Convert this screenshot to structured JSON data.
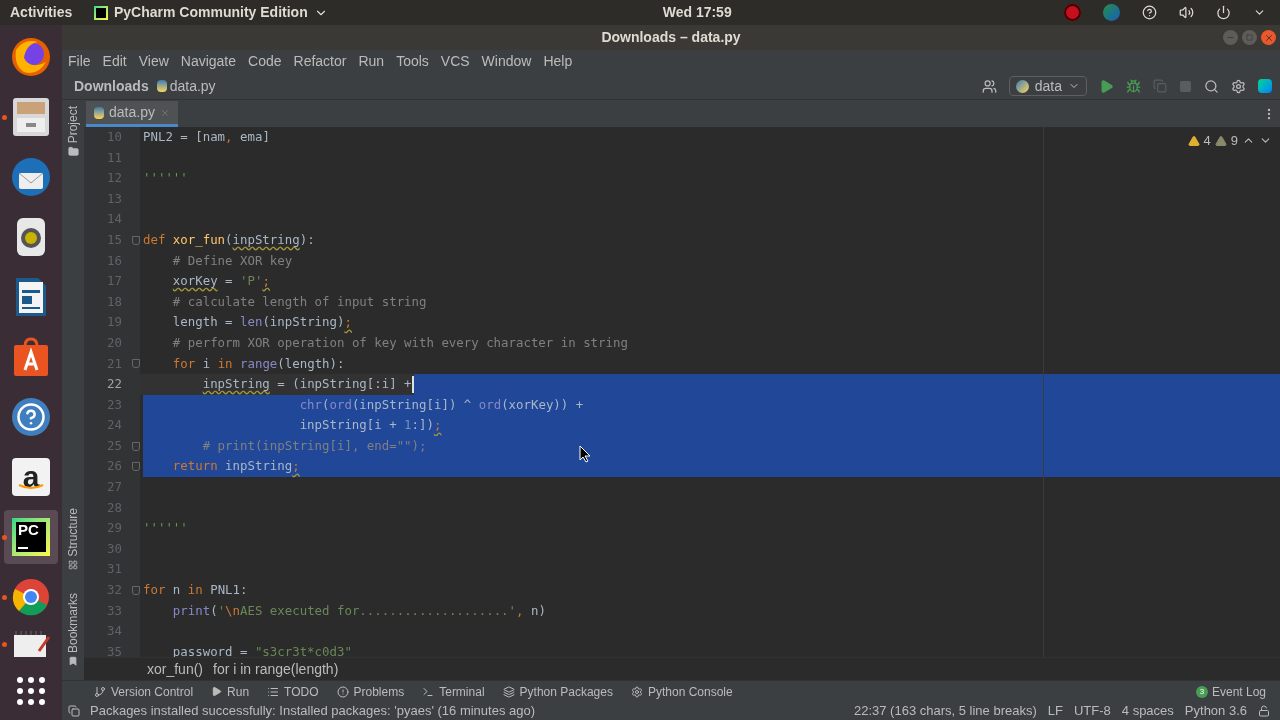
{
  "top_bar": {
    "activities": "Activities",
    "app_menu": "PyCharm Community Edition",
    "clock": "Wed 17:59"
  },
  "dock": [
    {
      "kind": "firefox",
      "running": false,
      "selected": false
    },
    {
      "kind": "files",
      "running": true,
      "selected": false
    },
    {
      "kind": "mail",
      "running": false,
      "selected": false
    },
    {
      "kind": "music",
      "running": false,
      "selected": false
    },
    {
      "kind": "writer",
      "running": false,
      "selected": false
    },
    {
      "kind": "software",
      "running": false,
      "selected": false
    },
    {
      "kind": "help",
      "running": false,
      "selected": false
    },
    {
      "kind": "shop",
      "label": "a",
      "running": false,
      "selected": false
    },
    {
      "kind": "ide",
      "label": "PC",
      "running": true,
      "selected": true
    },
    {
      "kind": "chrome",
      "running": true,
      "selected": false
    },
    {
      "kind": "notes",
      "running": true,
      "selected": false
    },
    {
      "kind": "apps",
      "running": false,
      "selected": false
    }
  ],
  "window": {
    "title": "Downloads – data.py"
  },
  "menu": [
    "File",
    "Edit",
    "View",
    "Navigate",
    "Code",
    "Refactor",
    "Run",
    "Tools",
    "VCS",
    "Window",
    "Help"
  ],
  "nav": {
    "breadcrumb": [
      "Downloads",
      "data.py"
    ],
    "run_config": "data"
  },
  "tabs": [
    {
      "label": "data.py",
      "selected": true
    }
  ],
  "side_tools": {
    "top": [
      "Project"
    ],
    "bottom": [
      "Structure",
      "Bookmarks"
    ]
  },
  "editor": {
    "warnings": "4",
    "weak_warnings": "9",
    "lines": [
      {
        "number": "10",
        "selected": false,
        "caret": false,
        "tokens": [
          {
            "t": "PNL2 = [nam",
            "kind": "plain"
          },
          {
            "t": ",",
            "kind": "keyword"
          },
          {
            "t": " ema]",
            "kind": "plain"
          }
        ]
      },
      {
        "number": "11",
        "selected": false,
        "caret": false
      },
      {
        "number": "12",
        "selected": false,
        "caret": false,
        "tokens": [
          {
            "t": "''''''",
            "kind": "docstring"
          }
        ]
      },
      {
        "number": "13",
        "selected": false,
        "caret": false
      },
      {
        "number": "14",
        "selected": false,
        "caret": false
      },
      {
        "number": "15",
        "selected": false,
        "caret": false,
        "fold": true,
        "tokens": [
          {
            "t": "def ",
            "kind": "keyword"
          },
          {
            "t": "xor_fun",
            "kind": "function"
          },
          {
            "t": "(",
            "kind": "plain"
          },
          {
            "t": "inpString",
            "kind": "plain",
            "warn": true
          },
          {
            "t": "):",
            "kind": "plain"
          }
        ]
      },
      {
        "number": "16",
        "selected": false,
        "caret": false,
        "tokens": [
          {
            "t": "    # Define XOR key",
            "kind": "comment"
          }
        ]
      },
      {
        "number": "17",
        "selected": false,
        "caret": false,
        "tokens": [
          {
            "t": "    xorKey",
            "kind": "plain",
            "warn": true
          },
          {
            "t": " = ",
            "kind": "plain"
          },
          {
            "t": "'P'",
            "kind": "string"
          },
          {
            "t": ";",
            "kind": "keyword",
            "warn": true
          }
        ]
      },
      {
        "number": "18",
        "selected": false,
        "caret": false,
        "tokens": [
          {
            "t": "    # calculate length of input string",
            "kind": "comment"
          }
        ]
      },
      {
        "number": "19",
        "selected": false,
        "caret": false,
        "tokens": [
          {
            "t": "    length = ",
            "kind": "plain"
          },
          {
            "t": "len",
            "kind": "builtin"
          },
          {
            "t": "(inpString)",
            "kind": "plain"
          },
          {
            "t": ";",
            "kind": "keyword",
            "warn": true
          }
        ]
      },
      {
        "number": "20",
        "selected": false,
        "caret": false,
        "tokens": [
          {
            "t": "    # perform XOR operation of key with every character in string",
            "kind": "comment"
          }
        ]
      },
      {
        "number": "21",
        "selected": false,
        "caret": false,
        "fold": true,
        "tokens": [
          {
            "t": "    for",
            "kind": "keyword"
          },
          {
            "t": " i ",
            "kind": "plain"
          },
          {
            "t": "in",
            "kind": "keyword"
          },
          {
            "t": " range",
            "kind": "builtin"
          },
          {
            "t": "(length):",
            "kind": "plain"
          }
        ]
      },
      {
        "number": "22",
        "selected": false,
        "caret": true,
        "tokens": [
          {
            "t": "        inpString",
            "kind": "plain",
            "warn": true
          },
          {
            "t": " = (inpString[:i] +",
            "kind": "plain"
          }
        ]
      },
      {
        "number": "23",
        "selected": true,
        "caret": false,
        "tokens": [
          {
            "t": "                     chr",
            "kind": "builtin"
          },
          {
            "t": "(",
            "kind": "plain"
          },
          {
            "t": "ord",
            "kind": "builtin"
          },
          {
            "t": "(inpString[i]) ^ ",
            "kind": "plain"
          },
          {
            "t": "ord",
            "kind": "builtin"
          },
          {
            "t": "(xorKey)) +",
            "kind": "plain"
          }
        ]
      },
      {
        "number": "24",
        "selected": true,
        "caret": false,
        "tokens": [
          {
            "t": "                     inpString[i + ",
            "kind": "plain"
          },
          {
            "t": "1",
            "kind": "number"
          },
          {
            "t": ":])",
            "kind": "plain"
          },
          {
            "t": ";",
            "kind": "keyword",
            "warn": true
          }
        ]
      },
      {
        "number": "25",
        "selected": true,
        "caret": false,
        "fold": true,
        "tokens": [
          {
            "t": "        # print(inpString[i], end=\"\");",
            "kind": "comment"
          }
        ]
      },
      {
        "number": "26",
        "selected": true,
        "caret": false,
        "fold": true,
        "tokens": [
          {
            "t": "    return",
            "kind": "keyword"
          },
          {
            "t": " inpString",
            "kind": "plain"
          },
          {
            "t": ";",
            "kind": "keyword",
            "warn": true
          }
        ]
      },
      {
        "number": "27",
        "selected": false,
        "caret": false
      },
      {
        "number": "28",
        "selected": false,
        "caret": false
      },
      {
        "number": "29",
        "selected": false,
        "caret": false,
        "tokens": [
          {
            "t": "''''''",
            "kind": "docstring"
          }
        ]
      },
      {
        "number": "30",
        "selected": false,
        "caret": false
      },
      {
        "number": "31",
        "selected": false,
        "caret": false
      },
      {
        "number": "32",
        "selected": false,
        "caret": false,
        "fold": true,
        "tokens": [
          {
            "t": "for",
            "kind": "keyword"
          },
          {
            "t": " n ",
            "kind": "plain"
          },
          {
            "t": "in",
            "kind": "keyword"
          },
          {
            "t": " PNL1:",
            "kind": "plain"
          }
        ]
      },
      {
        "number": "33",
        "selected": false,
        "caret": false,
        "tokens": [
          {
            "t": "    print",
            "kind": "builtin"
          },
          {
            "t": "(",
            "kind": "plain"
          },
          {
            "t": "'",
            "kind": "string"
          },
          {
            "t": "\\n",
            "kind": "escape"
          },
          {
            "t": "AES executed for....................'",
            "kind": "string"
          },
          {
            "t": ",",
            "kind": "keyword"
          },
          {
            "t": " n)",
            "kind": "plain"
          }
        ]
      },
      {
        "number": "34",
        "selected": false,
        "caret": false
      },
      {
        "number": "35",
        "selected": false,
        "caret": false,
        "tokens": [
          {
            "t": "    password = ",
            "kind": "plain"
          },
          {
            "t": "\"s3cr3t*c0d3\"",
            "kind": "string"
          }
        ]
      }
    ]
  },
  "breadcrumb": [
    "xor_fun()",
    "for i in range(length)"
  ],
  "tool_windows": [
    {
      "label": "Version Control",
      "kind": "vcs"
    },
    {
      "label": "Run",
      "kind": "run"
    },
    {
      "label": "TODO",
      "kind": "todo"
    },
    {
      "label": "Problems",
      "kind": "problems"
    },
    {
      "label": "Terminal",
      "kind": "terminal"
    },
    {
      "label": "Python Packages",
      "kind": "packages"
    },
    {
      "label": "Python Console",
      "kind": "console"
    }
  ],
  "event_log": {
    "label": "Event Log",
    "count": "3"
  },
  "status": {
    "message": "Packages installed successfully: Installed packages: 'pyaes' (16 minutes ago)",
    "position": "22:37 (163 chars, 5 line breaks)",
    "line_sep": "LF",
    "encoding": "UTF-8",
    "indent": "4 spaces",
    "interpreter": "Python 3.6"
  }
}
